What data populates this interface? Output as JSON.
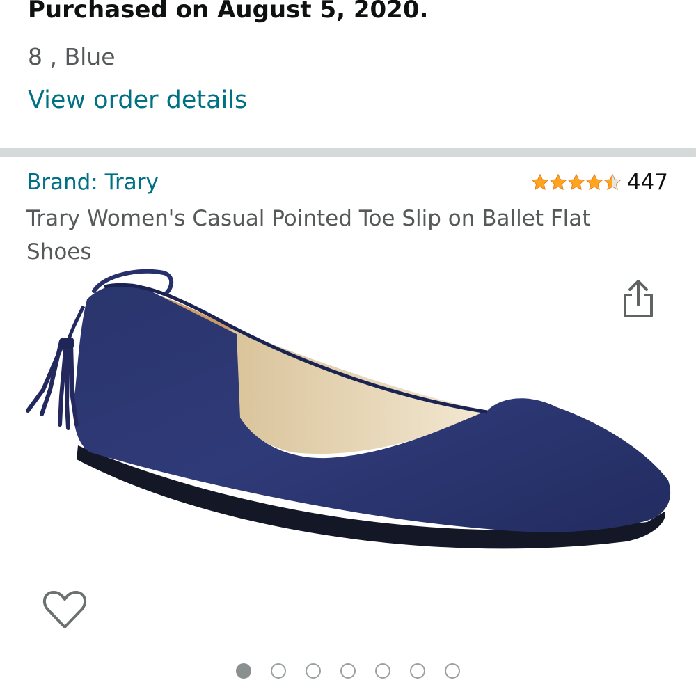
{
  "order": {
    "purchased_text": "Purchased on August 5, 2020.",
    "variant_text": "8 , Blue",
    "view_details_label": "View order details"
  },
  "product": {
    "brand_label": "Brand: Trary",
    "rating": 4.5,
    "rating_max": 5,
    "review_count": "447",
    "title": "Trary Women's Casual Pointed Toe Slip on Ballet Flat Shoes",
    "image": {
      "alt": "Navy blue pointed toe ballet flat with tassel"
    }
  },
  "carousel": {
    "total": 7,
    "active_index": 0
  },
  "icons": {
    "share": "share-icon",
    "wishlist": "heart-icon",
    "star": "star-icon"
  },
  "colors": {
    "link": "#007185",
    "star_fill": "#ffa41c",
    "star_empty": "#e3e6e6",
    "shoe": "#2c3770"
  }
}
